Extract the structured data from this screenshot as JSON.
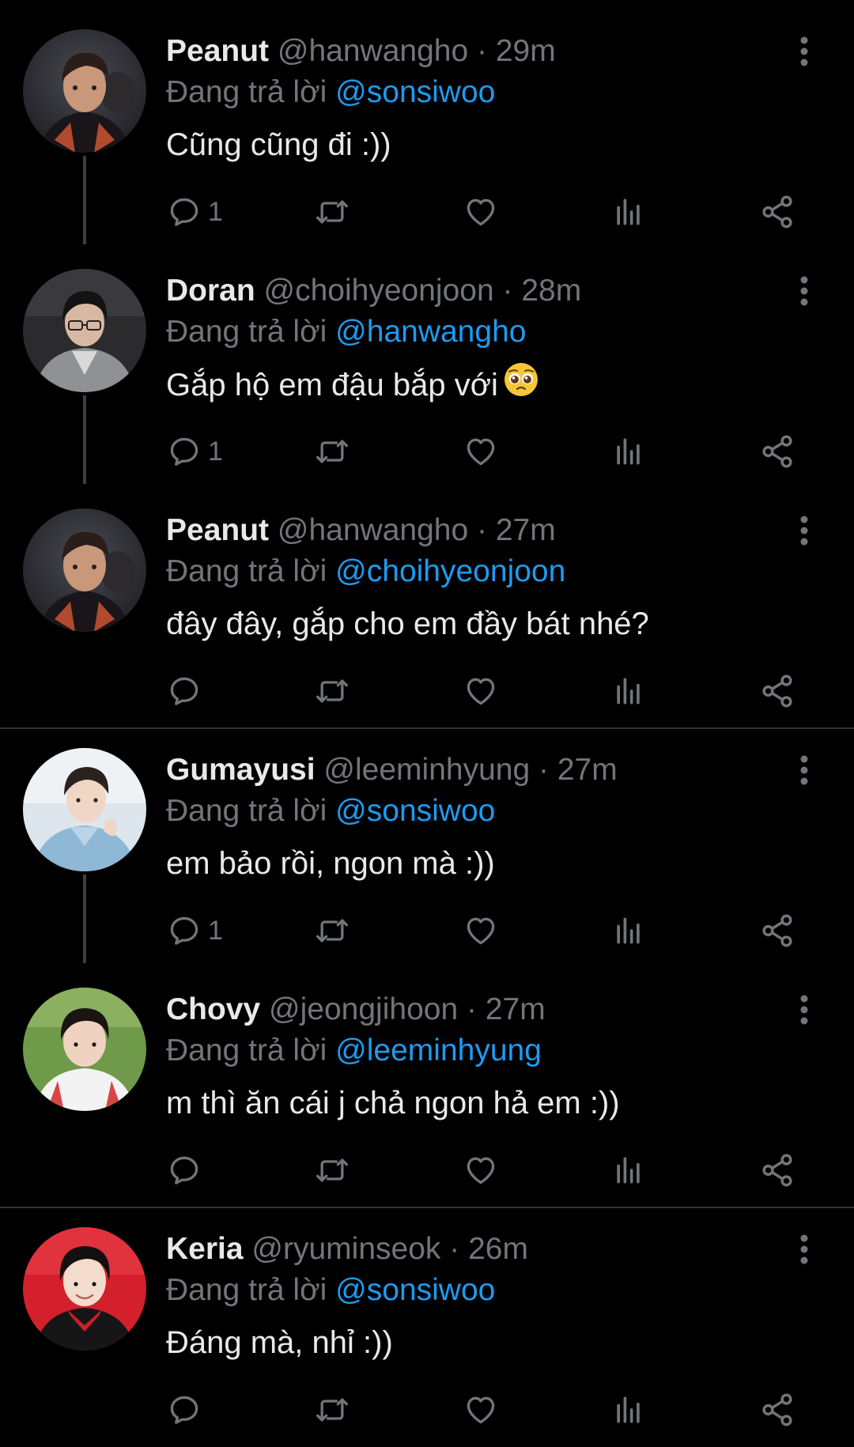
{
  "reply_prefix": "Đang trả lời",
  "tweets": [
    {
      "name": "Peanut",
      "handle": "@hanwangho",
      "time": "29m",
      "reply_to": "@sonsiwoo",
      "text": "Cũng cũng đi :))",
      "reply_count": "1",
      "avatar": "peanut-avatar"
    },
    {
      "name": "Doran",
      "handle": "@choihyeonjoon",
      "time": "28m",
      "reply_to": "@hanwangho",
      "text": "Gắp hộ em đậu bắp với",
      "emoji": "pleading-face-emoji",
      "reply_count": "1",
      "avatar": "doran-avatar"
    },
    {
      "name": "Peanut",
      "handle": "@hanwangho",
      "time": "27m",
      "reply_to": "@choihyeonjoon",
      "text": "đây đây, gắp cho em đầy bát nhé?",
      "reply_count": "",
      "avatar": "peanut-avatar"
    },
    {
      "name": "Gumayusi",
      "handle": "@leeminhyung",
      "time": "27m",
      "reply_to": "@sonsiwoo",
      "text": "em bảo rồi, ngon mà :))",
      "reply_count": "1",
      "avatar": "gumayusi-avatar"
    },
    {
      "name": "Chovy",
      "handle": "@jeongjihoon",
      "time": "27m",
      "reply_to": "@leeminhyung",
      "text": "m thì ăn cái j chả ngon hả em :))",
      "reply_count": "",
      "avatar": "chovy-avatar"
    },
    {
      "name": "Keria",
      "handle": "@ryuminseok",
      "time": "26m",
      "reply_to": "@sonsiwoo",
      "text": "Đáng mà, nhỉ :))",
      "reply_count": "",
      "avatar": "keria-avatar"
    }
  ],
  "icons": [
    "reply-icon",
    "retweet-icon",
    "like-icon",
    "views-icon",
    "share-icon",
    "more-options-icon"
  ],
  "colors": {
    "background": "#000000",
    "text": "#e7e9ea",
    "muted": "#71767b",
    "mention": "#1d9bf0",
    "divider": "#2f3336",
    "thread_line": "#3e4144"
  }
}
